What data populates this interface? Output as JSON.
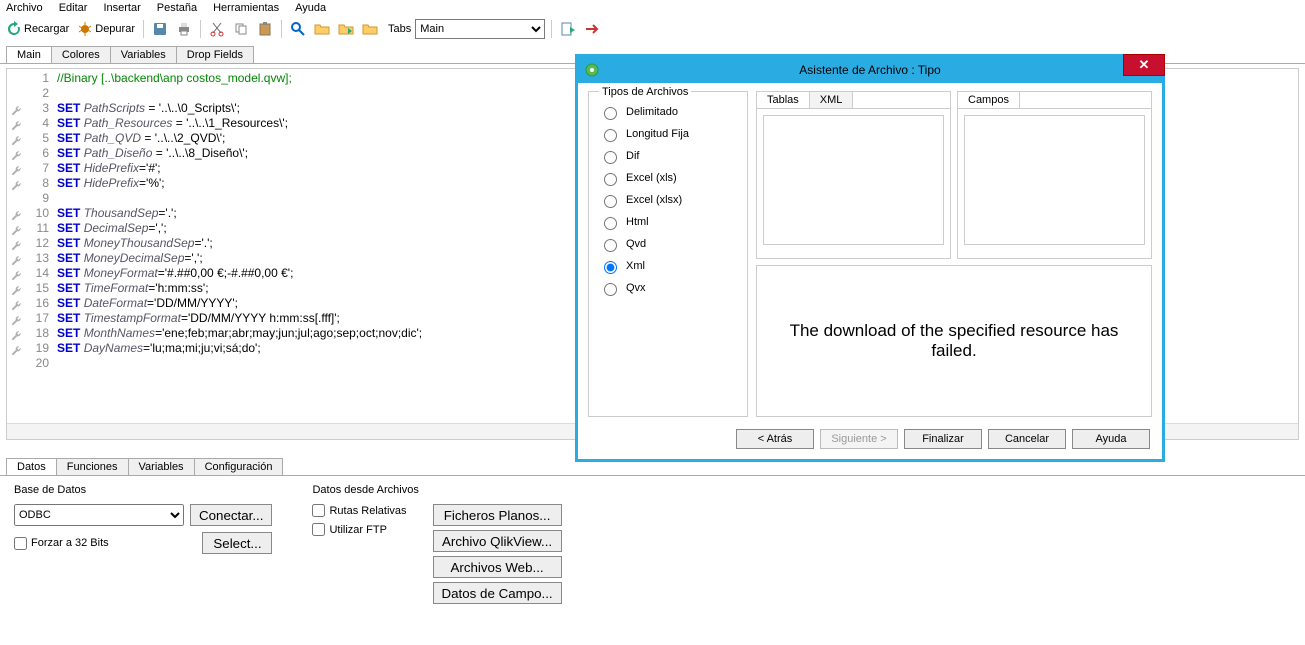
{
  "menu": [
    "Archivo",
    "Editar",
    "Insertar",
    "Pestaña",
    "Herramientas",
    "Ayuda"
  ],
  "toolbar": {
    "reload": "Recargar",
    "debug": "Depurar",
    "tabs_label": "Tabs",
    "tabs_value": "Main"
  },
  "script_tabs": [
    "Main",
    "Colores",
    "Variables",
    "Drop Fields"
  ],
  "code_lines": [
    {
      "n": 1,
      "html": "<span class='com'>//Binary [..\\backend\\anp costos_model.qvw];</span>",
      "w": false
    },
    {
      "n": 2,
      "html": "",
      "w": false
    },
    {
      "n": 3,
      "html": "<span class='kw'>SET</span> <span class='id'>PathScripts</span> = '..\\..\\0_Scripts\\';",
      "w": true
    },
    {
      "n": 4,
      "html": "<span class='kw'>SET</span> <span class='id'>Path_Resources</span> = '..\\..\\1_Resources\\';",
      "w": true
    },
    {
      "n": 5,
      "html": "<span class='kw'>SET</span> <span class='id'>Path_QVD</span> = '..\\..\\2_QVD\\';",
      "w": true
    },
    {
      "n": 6,
      "html": "<span class='kw'>SET</span> <span class='id'>Path_Diseño</span> = '..\\..\\8_Diseño\\';",
      "w": true
    },
    {
      "n": 7,
      "html": "<span class='kw'>SET</span> <span class='id'>HidePrefix</span>='#';",
      "w": true
    },
    {
      "n": 8,
      "html": "<span class='kw'>SET</span> <span class='id'>HidePrefix</span>='%';",
      "w": true
    },
    {
      "n": 9,
      "html": "",
      "w": false
    },
    {
      "n": 10,
      "html": "<span class='kw'>SET</span> <span class='id'>ThousandSep</span>='.';",
      "w": true
    },
    {
      "n": 11,
      "html": "<span class='kw'>SET</span> <span class='id'>DecimalSep</span>=',';",
      "w": true
    },
    {
      "n": 12,
      "html": "<span class='kw'>SET</span> <span class='id'>MoneyThousandSep</span>='.';",
      "w": true
    },
    {
      "n": 13,
      "html": "<span class='kw'>SET</span> <span class='id'>MoneyDecimalSep</span>=',';",
      "w": true
    },
    {
      "n": 14,
      "html": "<span class='kw'>SET</span> <span class='id'>MoneyFormat</span>='#.##0,00 €;-#.##0,00 €';",
      "w": true
    },
    {
      "n": 15,
      "html": "<span class='kw'>SET</span> <span class='id'>TimeFormat</span>='h:mm:ss';",
      "w": true
    },
    {
      "n": 16,
      "html": "<span class='kw'>SET</span> <span class='id'>DateFormat</span>='DD/MM/YYYY';",
      "w": true
    },
    {
      "n": 17,
      "html": "<span class='kw'>SET</span> <span class='id'>TimestampFormat</span>='DD/MM/YYYY h:mm:ss[.fff]';",
      "w": true
    },
    {
      "n": 18,
      "html": "<span class='kw'>SET</span> <span class='id'>MonthNames</span>='ene;feb;mar;abr;may;jun;jul;ago;sep;oct;nov;dic';",
      "w": true
    },
    {
      "n": 19,
      "html": "<span class='kw'>SET</span> <span class='id'>DayNames</span>='lu;ma;mi;ju;vi;sá;do';",
      "w": true
    },
    {
      "n": 20,
      "html": "",
      "w": false
    }
  ],
  "bottom_tabs": [
    "Datos",
    "Funciones",
    "Variables",
    "Configuración"
  ],
  "bottom": {
    "db_title": "Base de Datos",
    "db_value": "ODBC",
    "connect": "Conectar...",
    "select": "Select...",
    "force32": "Forzar a 32 Bits",
    "files_title": "Datos desde Archivos",
    "rel_paths": "Rutas Relativas",
    "use_ftp": "Utilizar FTP",
    "flat": "Ficheros Planos...",
    "qv": "Archivo QlikView...",
    "web": "Archivos Web...",
    "field": "Datos de Campo..."
  },
  "dialog": {
    "title": "Asistente de Archivo : Tipo",
    "ft_title": "Tipos de Archivos",
    "types": [
      "Delimitado",
      "Longitud Fija",
      "Dif",
      "Excel (xls)",
      "Excel (xlsx)",
      "Html",
      "Qvd",
      "Xml",
      "Qvx"
    ],
    "selected_type": "Xml",
    "tabs": [
      "Tablas",
      "XML"
    ],
    "campos": "Campos",
    "error": "The download of the specified resource has failed.",
    "back": "< Atrás",
    "next": "Siguiente >",
    "finish": "Finalizar",
    "cancel": "Cancelar",
    "help": "Ayuda"
  }
}
